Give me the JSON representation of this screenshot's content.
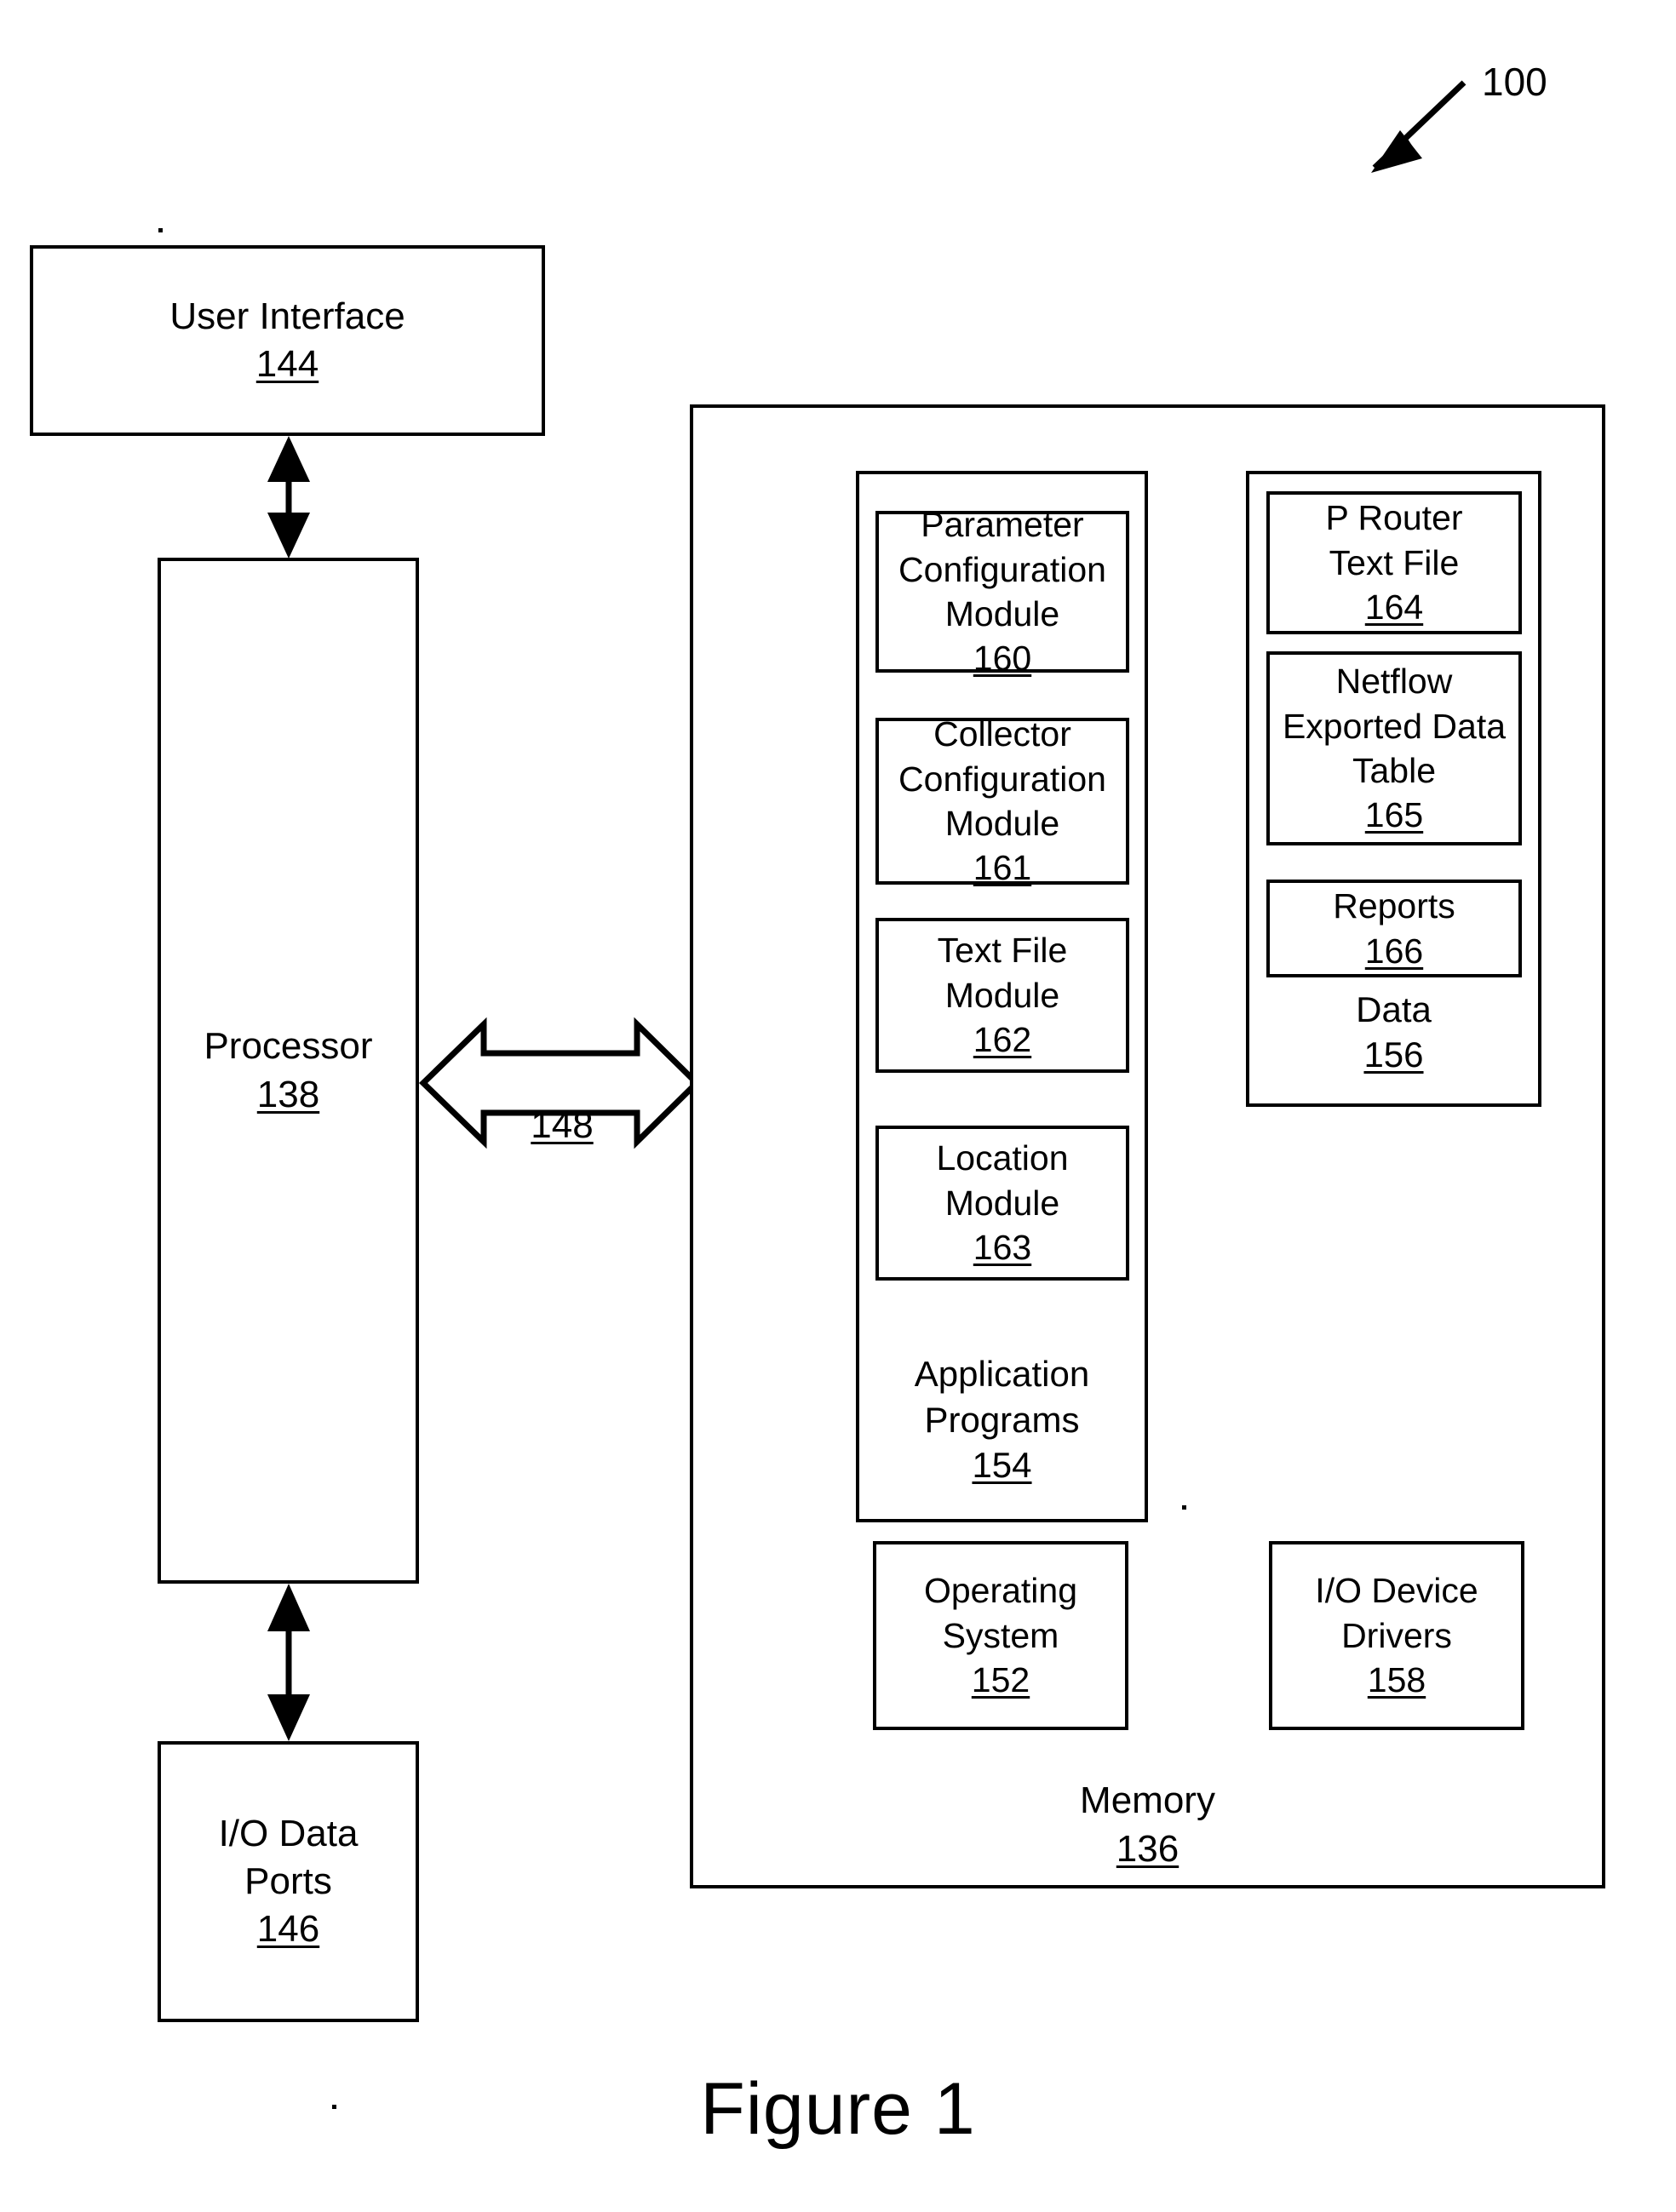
{
  "figure": {
    "caption": "Figure 1",
    "system_ref": "100"
  },
  "left_column": {
    "user_interface": {
      "label": "User Interface",
      "ref": "144"
    },
    "processor": {
      "label": "Processor",
      "ref": "138"
    },
    "io_data_ports": {
      "label": "I/O Data\nPorts",
      "ref": "146"
    },
    "bus": {
      "ref": "148"
    }
  },
  "memory": {
    "label": "Memory",
    "ref": "136",
    "application_programs": {
      "label": "Application\nPrograms",
      "ref": "154",
      "modules": [
        {
          "label": "Parameter\nConfiguration\nModule",
          "ref": "160"
        },
        {
          "label": "Collector\nConfiguration\nModule",
          "ref": "161"
        },
        {
          "label": "Text File\nModule",
          "ref": "162"
        },
        {
          "label": "Location\nModule",
          "ref": "163"
        }
      ]
    },
    "data": {
      "label": "Data",
      "ref": "156",
      "items": [
        {
          "label": "P Router\nText File",
          "ref": "164"
        },
        {
          "label": "Netflow\nExported Data\nTable",
          "ref": "165"
        },
        {
          "label": "Reports",
          "ref": "166"
        }
      ]
    },
    "operating_system": {
      "label": "Operating\nSystem",
      "ref": "152"
    },
    "io_device_drivers": {
      "label": "I/O Device\nDrivers",
      "ref": "158"
    }
  }
}
